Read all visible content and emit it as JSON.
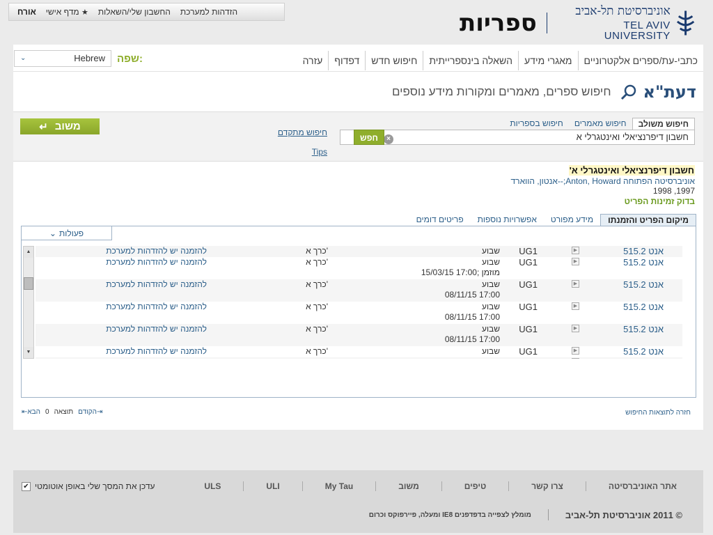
{
  "userbar": {
    "guest": "אורח",
    "personal_shelf": "מדף אישי",
    "account": "החשבון שלי/השאלות",
    "login": "הזדהות למערכת"
  },
  "logo": {
    "university_he": "אוניברסיטת תל-אביב",
    "university_en": "TEL AVIV UNIVERSITY",
    "libraries": "ספריות"
  },
  "nav": {
    "items": [
      "כתבי-עת/ספרים אלקטרוניים",
      "מאגרי מידע",
      "השאלה בינספרייתית",
      "חיפוש חדש",
      "דפדוף",
      "עזרה"
    ],
    "language_label": "שפה:",
    "language_value": "Hebrew"
  },
  "daat": {
    "logo": "דעת\"א",
    "subtitle": "חיפוש ספרים, מאמרים ומקורות מידע נוספים"
  },
  "search": {
    "tabs": [
      "חיפוש משולב",
      "חיפוש מאמרים",
      "חיפוש בספריות"
    ],
    "query": "חשבון דיפרנציאלי ואינטגרלי א",
    "go_label": "חפש",
    "advanced": "חיפוש מתקדם",
    "tips": "Tips",
    "feedback": "משוב"
  },
  "record": {
    "title": "חשבון דיפרנציאלי ואינטגרלי א'",
    "publisher": "אוניברסיטה הפתוחה",
    "authors": "Anton, Howard;--אנטון, הווארד",
    "dates": "1997, 1998",
    "availability": "בדוק זמינות הפריט"
  },
  "detail_tabs": [
    "מיקום הפריט והזמנתו",
    "מידע מפורט",
    "אפשרויות נוספות",
    "פריטים דומים"
  ],
  "actions_label": "פעולות",
  "holdings": [
    {
      "call": "515.2 אנט",
      "loc": "UG1",
      "status": [
        "שבוע"
      ],
      "vol": "כרך א'",
      "req": "להזמנה יש להזדהות למערכת"
    },
    {
      "call": "515.2 אנט",
      "loc": "UG1",
      "status": [
        "שבוע",
        "15/03/15 17:00; מוזמן"
      ],
      "vol": "כרך א'",
      "req": "להזמנה יש להזדהות למערכת"
    },
    {
      "call": "515.2 אנט",
      "loc": "UG1",
      "status": [
        "שבוע",
        "08/11/15 17:00"
      ],
      "vol": "כרך א'",
      "req": "להזמנה יש להזדהות למערכת"
    },
    {
      "call": "515.2 אנט",
      "loc": "UG1",
      "status": [
        "שבוע",
        "08/11/15 17:00"
      ],
      "vol": "כרך א'",
      "req": "להזמנה יש להזדהות למערכת"
    },
    {
      "call": "515.2 אנט",
      "loc": "UG1",
      "status": [
        "שבוע",
        "08/11/15 17:00"
      ],
      "vol": "כרך א'",
      "req": "להזמנה יש להזדהות למערכת"
    },
    {
      "call": "515.2 אנט",
      "loc": "UG1",
      "status": [
        "שבוע"
      ],
      "vol": "כרך א'",
      "req": "להזמנה יש להזדהות למערכת"
    },
    {
      "call": "515.2 אנט",
      "loc": "UG1",
      "status": [
        ""
      ],
      "vol": "",
      "req": ""
    }
  ],
  "pager": {
    "prev": "הקודם",
    "result_label": "תוצאה",
    "count": "0",
    "next": "הבא",
    "back_to_results": "חזרה לתוצאות החיפוש"
  },
  "footer": {
    "links": [
      "אתר האוניברסיטה",
      "צרו קשר",
      "טיפים",
      "משוב",
      "My Tau",
      "ULI",
      "ULS"
    ],
    "copyright": "© 2011 אוניברסיטת תל-אביב",
    "browser_note": "מומלץ לצפייה בדפדפנים IE8 ומעלה, פיירפוקס וכרום",
    "autofit": "עדכן את המסך שלי באופן אוטומטי"
  },
  "colors": {
    "accent_green": "#8fae2c",
    "link_blue": "#2c5f8a",
    "brand_navy": "#1a3a6e"
  }
}
